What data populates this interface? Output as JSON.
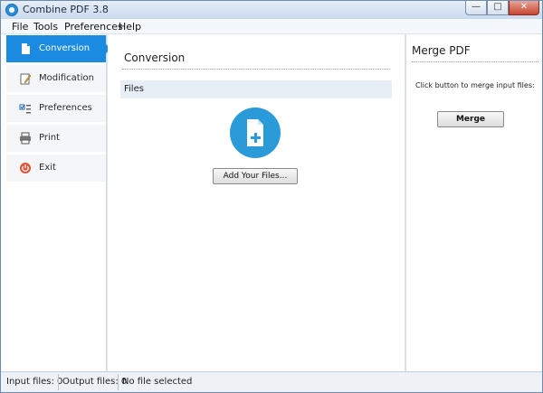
{
  "window": {
    "title": "Combine PDF 3.8"
  },
  "window_controls": {
    "minimize": "—",
    "maximize": "□",
    "close": "✕"
  },
  "menu": [
    "File",
    "Tools",
    "Preferences",
    "Help"
  ],
  "sidebar": {
    "items": [
      {
        "label": "Conversion",
        "icon": "document-icon",
        "active": true
      },
      {
        "label": "Modification",
        "icon": "edit-icon",
        "active": false
      },
      {
        "label": "Preferences",
        "icon": "checklist-icon",
        "active": false
      },
      {
        "label": "Print",
        "icon": "printer-icon",
        "active": false
      },
      {
        "label": "Exit",
        "icon": "power-icon",
        "active": false
      }
    ]
  },
  "main": {
    "title": "Conversion",
    "files_header": "Files",
    "add_button": "Add Your Files..."
  },
  "right_panel": {
    "title": "Merge PDF",
    "hint": "Click button to merge input files:",
    "merge_button": "Merge"
  },
  "status": {
    "input_files": "Input files: 0",
    "output_files": "Output files: 0",
    "selection": "No file selected"
  },
  "colors": {
    "accent": "#1a8be0",
    "add_circle": "#2a9bd8",
    "exit_icon": "#e0533a"
  }
}
